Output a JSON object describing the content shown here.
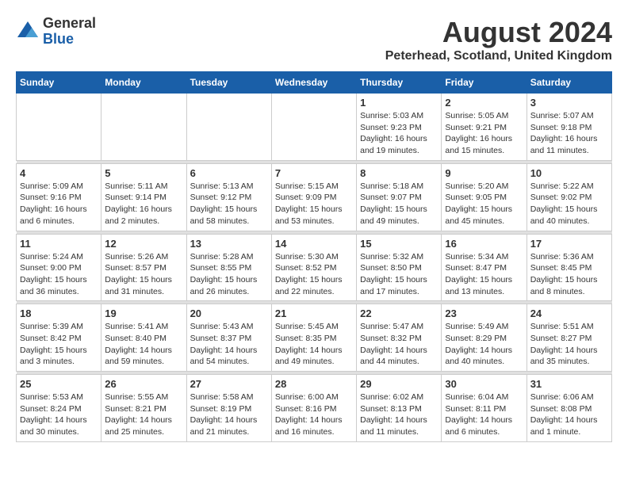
{
  "header": {
    "logo_general": "General",
    "logo_blue": "Blue",
    "title": "August 2024",
    "subtitle": "Peterhead, Scotland, United Kingdom"
  },
  "weekdays": [
    "Sunday",
    "Monday",
    "Tuesday",
    "Wednesday",
    "Thursday",
    "Friday",
    "Saturday"
  ],
  "weeks": [
    [
      {
        "day": "",
        "info": ""
      },
      {
        "day": "",
        "info": ""
      },
      {
        "day": "",
        "info": ""
      },
      {
        "day": "",
        "info": ""
      },
      {
        "day": "1",
        "info": "Sunrise: 5:03 AM\nSunset: 9:23 PM\nDaylight: 16 hours\nand 19 minutes."
      },
      {
        "day": "2",
        "info": "Sunrise: 5:05 AM\nSunset: 9:21 PM\nDaylight: 16 hours\nand 15 minutes."
      },
      {
        "day": "3",
        "info": "Sunrise: 5:07 AM\nSunset: 9:18 PM\nDaylight: 16 hours\nand 11 minutes."
      }
    ],
    [
      {
        "day": "4",
        "info": "Sunrise: 5:09 AM\nSunset: 9:16 PM\nDaylight: 16 hours\nand 6 minutes."
      },
      {
        "day": "5",
        "info": "Sunrise: 5:11 AM\nSunset: 9:14 PM\nDaylight: 16 hours\nand 2 minutes."
      },
      {
        "day": "6",
        "info": "Sunrise: 5:13 AM\nSunset: 9:12 PM\nDaylight: 15 hours\nand 58 minutes."
      },
      {
        "day": "7",
        "info": "Sunrise: 5:15 AM\nSunset: 9:09 PM\nDaylight: 15 hours\nand 53 minutes."
      },
      {
        "day": "8",
        "info": "Sunrise: 5:18 AM\nSunset: 9:07 PM\nDaylight: 15 hours\nand 49 minutes."
      },
      {
        "day": "9",
        "info": "Sunrise: 5:20 AM\nSunset: 9:05 PM\nDaylight: 15 hours\nand 45 minutes."
      },
      {
        "day": "10",
        "info": "Sunrise: 5:22 AM\nSunset: 9:02 PM\nDaylight: 15 hours\nand 40 minutes."
      }
    ],
    [
      {
        "day": "11",
        "info": "Sunrise: 5:24 AM\nSunset: 9:00 PM\nDaylight: 15 hours\nand 36 minutes."
      },
      {
        "day": "12",
        "info": "Sunrise: 5:26 AM\nSunset: 8:57 PM\nDaylight: 15 hours\nand 31 minutes."
      },
      {
        "day": "13",
        "info": "Sunrise: 5:28 AM\nSunset: 8:55 PM\nDaylight: 15 hours\nand 26 minutes."
      },
      {
        "day": "14",
        "info": "Sunrise: 5:30 AM\nSunset: 8:52 PM\nDaylight: 15 hours\nand 22 minutes."
      },
      {
        "day": "15",
        "info": "Sunrise: 5:32 AM\nSunset: 8:50 PM\nDaylight: 15 hours\nand 17 minutes."
      },
      {
        "day": "16",
        "info": "Sunrise: 5:34 AM\nSunset: 8:47 PM\nDaylight: 15 hours\nand 13 minutes."
      },
      {
        "day": "17",
        "info": "Sunrise: 5:36 AM\nSunset: 8:45 PM\nDaylight: 15 hours\nand 8 minutes."
      }
    ],
    [
      {
        "day": "18",
        "info": "Sunrise: 5:39 AM\nSunset: 8:42 PM\nDaylight: 15 hours\nand 3 minutes."
      },
      {
        "day": "19",
        "info": "Sunrise: 5:41 AM\nSunset: 8:40 PM\nDaylight: 14 hours\nand 59 minutes."
      },
      {
        "day": "20",
        "info": "Sunrise: 5:43 AM\nSunset: 8:37 PM\nDaylight: 14 hours\nand 54 minutes."
      },
      {
        "day": "21",
        "info": "Sunrise: 5:45 AM\nSunset: 8:35 PM\nDaylight: 14 hours\nand 49 minutes."
      },
      {
        "day": "22",
        "info": "Sunrise: 5:47 AM\nSunset: 8:32 PM\nDaylight: 14 hours\nand 44 minutes."
      },
      {
        "day": "23",
        "info": "Sunrise: 5:49 AM\nSunset: 8:29 PM\nDaylight: 14 hours\nand 40 minutes."
      },
      {
        "day": "24",
        "info": "Sunrise: 5:51 AM\nSunset: 8:27 PM\nDaylight: 14 hours\nand 35 minutes."
      }
    ],
    [
      {
        "day": "25",
        "info": "Sunrise: 5:53 AM\nSunset: 8:24 PM\nDaylight: 14 hours\nand 30 minutes."
      },
      {
        "day": "26",
        "info": "Sunrise: 5:55 AM\nSunset: 8:21 PM\nDaylight: 14 hours\nand 25 minutes."
      },
      {
        "day": "27",
        "info": "Sunrise: 5:58 AM\nSunset: 8:19 PM\nDaylight: 14 hours\nand 21 minutes."
      },
      {
        "day": "28",
        "info": "Sunrise: 6:00 AM\nSunset: 8:16 PM\nDaylight: 14 hours\nand 16 minutes."
      },
      {
        "day": "29",
        "info": "Sunrise: 6:02 AM\nSunset: 8:13 PM\nDaylight: 14 hours\nand 11 minutes."
      },
      {
        "day": "30",
        "info": "Sunrise: 6:04 AM\nSunset: 8:11 PM\nDaylight: 14 hours\nand 6 minutes."
      },
      {
        "day": "31",
        "info": "Sunrise: 6:06 AM\nSunset: 8:08 PM\nDaylight: 14 hours\nand 1 minute."
      }
    ]
  ]
}
